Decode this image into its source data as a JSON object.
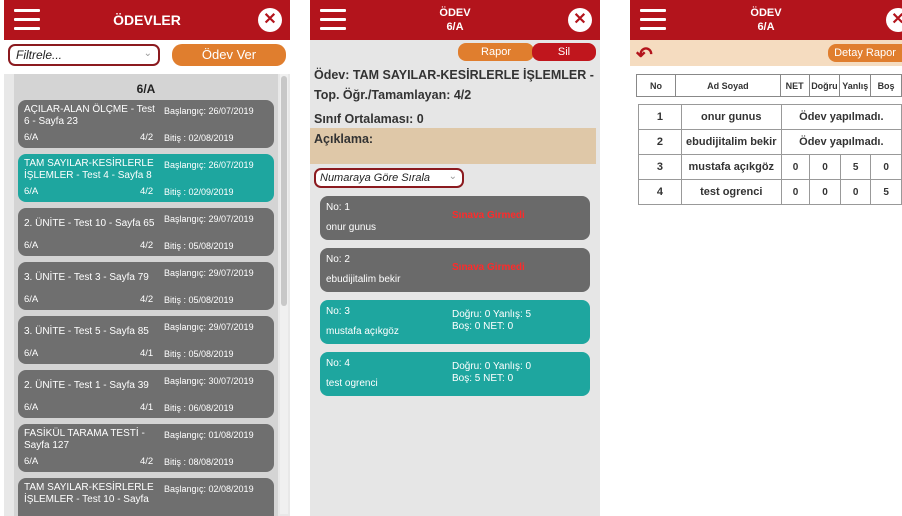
{
  "p1": {
    "title": "ÖDEVLER",
    "close": "✕",
    "filter_placeholder": "Filtrele...",
    "odev_ver": "Ödev Ver",
    "class_header": "6/A",
    "cards": [
      {
        "title": "AÇILAR-ALAN ÖLÇME - Test 6 - Sayfa 23",
        "start": "Başlangıç: 26/07/2019",
        "cls": "6/A",
        "count": "4/2",
        "end": "Bitiş      : 02/08/2019"
      },
      {
        "title": "TAM SAYILAR-KESİRLERLE İŞLEMLER - Test 4 - Sayfa 8",
        "start": "Başlangıç: 26/07/2019",
        "cls": "6/A",
        "count": "4/2",
        "end": "Bitiş      : 02/09/2019"
      },
      {
        "title": "2. ÜNİTE - Test 10 - Sayfa 65",
        "start": "Başlangıç: 29/07/2019",
        "cls": "6/A",
        "count": "4/2",
        "end": "Bitiş      : 05/08/2019"
      },
      {
        "title": "3. ÜNİTE - Test 3 - Sayfa 79",
        "start": "Başlangıç: 29/07/2019",
        "cls": "6/A",
        "count": "4/2",
        "end": "Bitiş      : 05/08/2019"
      },
      {
        "title": "3. ÜNİTE - Test 5 - Sayfa 85",
        "start": "Başlangıç: 29/07/2019",
        "cls": "6/A",
        "count": "4/1",
        "end": "Bitiş      : 05/08/2019"
      },
      {
        "title": "2. ÜNİTE - Test 1 - Sayfa 39",
        "start": "Başlangıç: 30/07/2019",
        "cls": "6/A",
        "count": "4/1",
        "end": "Bitiş      : 06/08/2019"
      },
      {
        "title": "FASİKÜL TARAMA TESTİ - Sayfa 127",
        "start": "Başlangıç: 01/08/2019",
        "cls": "6/A",
        "count": "4/2",
        "end": "Bitiş      : 08/08/2019"
      },
      {
        "title": "TAM SAYILAR-KESİRLERLE İŞLEMLER - Test 10 - Sayfa",
        "start": "Başlangıç: 02/08/2019",
        "cls": "",
        "count": "",
        "end": ""
      }
    ]
  },
  "p2": {
    "title_line1": "ÖDEV",
    "title_line2": "6/A",
    "close": "✕",
    "rapor": "Rapor",
    "sil": "Sil",
    "odev": "Ödev: TAM SAYILAR-KESİRLERLE İŞLEMLER -",
    "top": "Top. Öğr./Tamamlayan: 4/2",
    "ortalama": "Sınıf Ortalaması: 0",
    "aciklama": "Açıklama:",
    "sort": "Numaraya Göre Sırala",
    "students": [
      {
        "no": "No: 1",
        "name": "onur gunus",
        "status": "Sınava Girmedi",
        "r1": "",
        "r2": ""
      },
      {
        "no": "No: 2",
        "name": "ebudijitalim bekir",
        "status": "Sınava Girmedi",
        "r1": "",
        "r2": ""
      },
      {
        "no": "No: 3",
        "name": "mustafa açıkgöz",
        "status": "",
        "r1": "Doğru: 0  Yanlış: 5",
        "r2": "Boş: 0  NET: 0"
      },
      {
        "no": "No: 4",
        "name": "test ogrenci",
        "status": "",
        "r1": "Doğru: 0  Yanlış: 0",
        "r2": "Boş: 5  NET: 0"
      }
    ]
  },
  "p3": {
    "title_line1": "ÖDEV",
    "title_line2": "6/A",
    "close": "✕",
    "detay": "Detay Rapor",
    "headers": [
      "No",
      "Ad Soyad",
      "NET",
      "Doğru",
      "Yanlış",
      "Boş"
    ],
    "rows": [
      {
        "no": "1",
        "name": "onur gunus",
        "msg": "Ödev yapılmadı."
      },
      {
        "no": "2",
        "name": "ebudijitalim bekir",
        "msg": "Ödev yapılmadı."
      },
      {
        "no": "3",
        "name": "mustafa açıkgöz",
        "net": "0",
        "dogru": "0",
        "yanlis": "5",
        "bos": "0"
      },
      {
        "no": "4",
        "name": "test ogrenci",
        "net": "0",
        "dogru": "0",
        "yanlis": "0",
        "bos": "5"
      }
    ]
  }
}
